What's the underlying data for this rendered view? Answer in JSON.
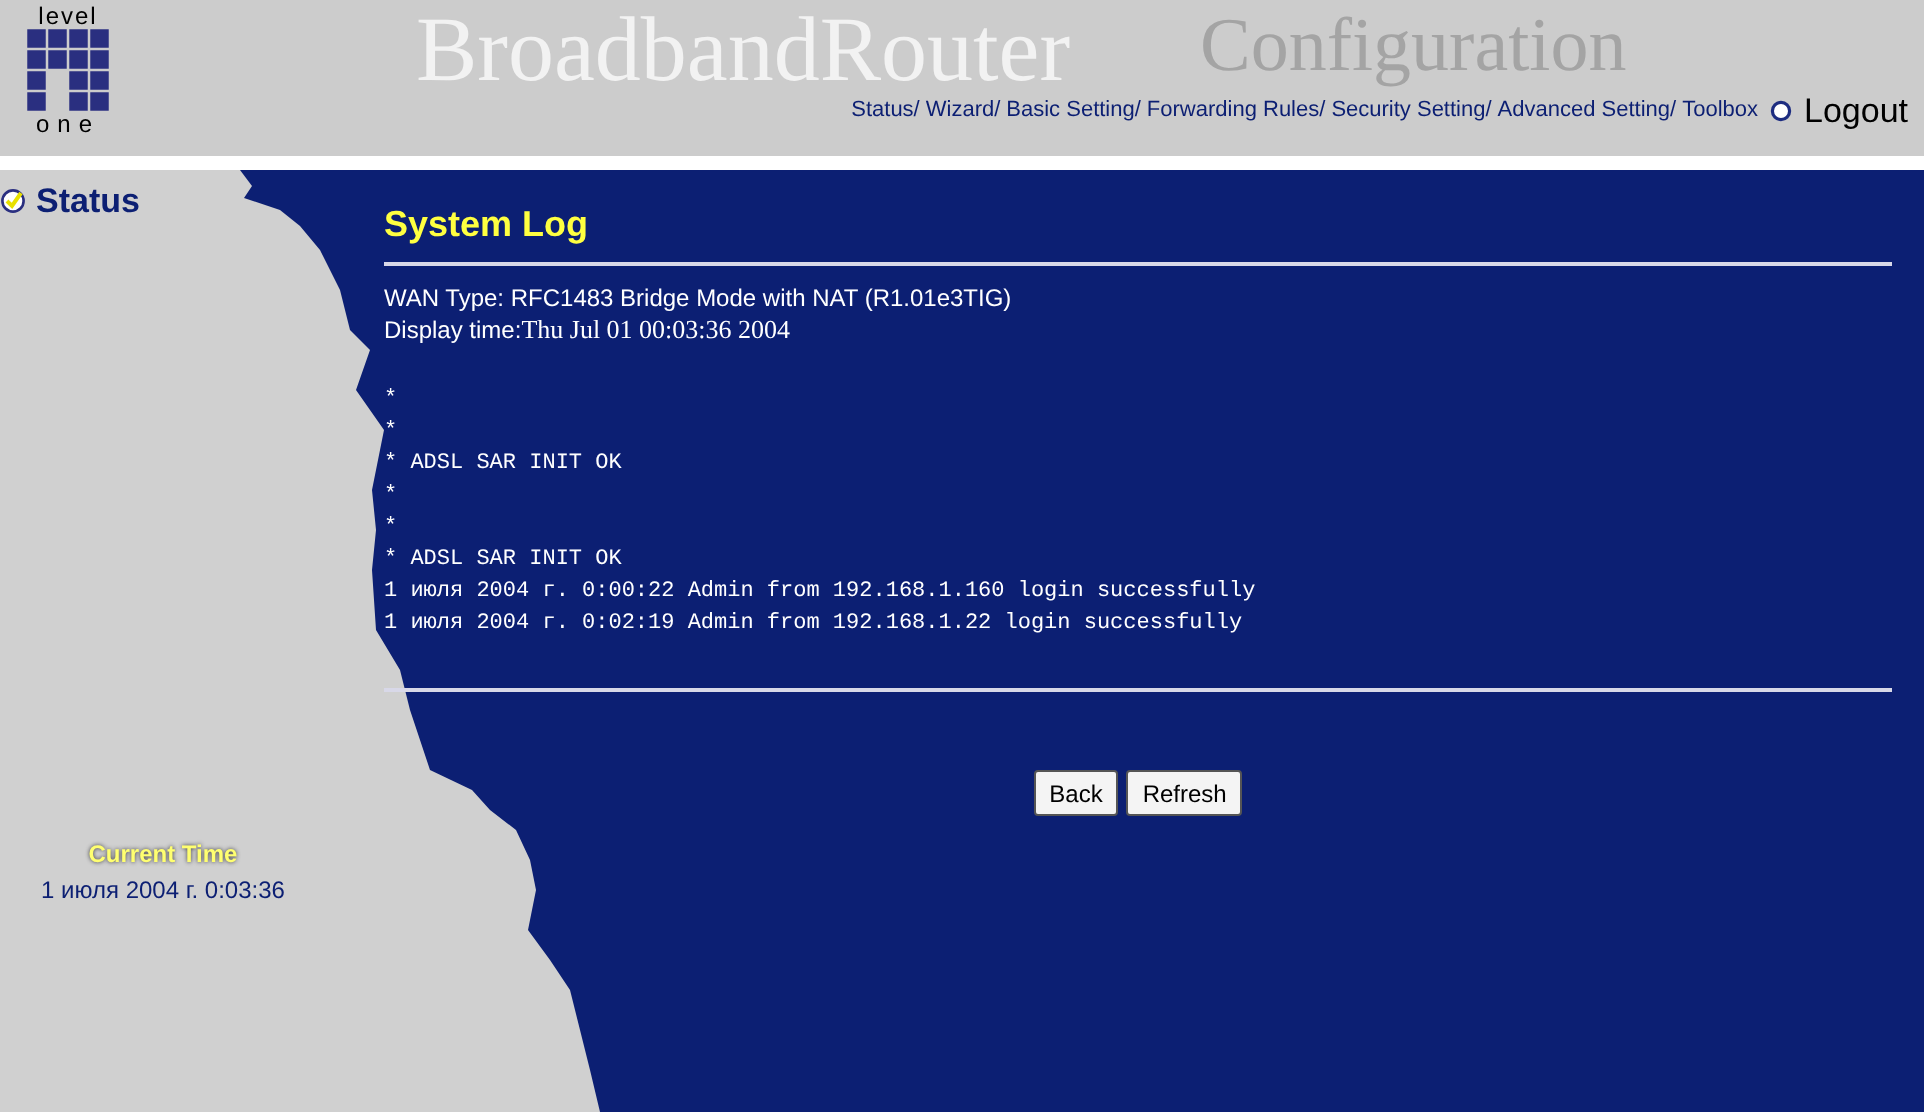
{
  "logo": {
    "top": "level",
    "bottom": "one"
  },
  "header": {
    "title": "BroadbandRouter",
    "subtitle": "Configuration"
  },
  "nav": [
    "Status/",
    "Wizard/",
    "Basic Setting/",
    "Forwarding Rules/",
    "Security Setting/",
    "Advanced Setting/",
    "Toolbox"
  ],
  "logout": "Logout",
  "sidebar": {
    "status": "Status",
    "current_time_label": "Current Time",
    "current_time": "1 июля 2004 г. 0:03:36"
  },
  "page": {
    "title": "System Log",
    "wan_type": "WAN Type: RFC1483 Bridge Mode with NAT (R1.01e3TIG)",
    "display_time_label": "Display time:",
    "display_time": "Thu Jul 01 00:03:36 2004"
  },
  "log_lines": [
    "*",
    "*",
    "* ADSL SAR INIT OK",
    "*",
    "*",
    "* ADSL SAR INIT OK",
    "1 июля 2004 г. 0:00:22 Admin from 192.168.1.160 login successfully",
    "1 июля 2004 г. 0:02:19 Admin from 192.168.1.22 login successfully"
  ],
  "buttons": [
    "Back",
    "Refresh"
  ]
}
